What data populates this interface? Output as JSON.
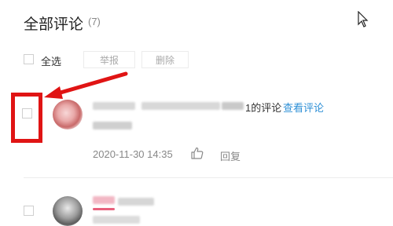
{
  "header": {
    "title": "全部评论",
    "count": "(7)"
  },
  "toolbar": {
    "select_all_label": "全选",
    "report_label": "举报",
    "delete_label": "删除"
  },
  "comments": [
    {
      "suffix_text": "1的评论",
      "view_link": "查看评论",
      "timestamp": "2020-11-30 14:35",
      "reply_label": "回复"
    }
  ],
  "colors": {
    "highlight_red": "#e01414",
    "link_blue": "#2d8fd6"
  },
  "icons": [
    "cursor-arrow-icon",
    "thumbs-up-icon"
  ]
}
